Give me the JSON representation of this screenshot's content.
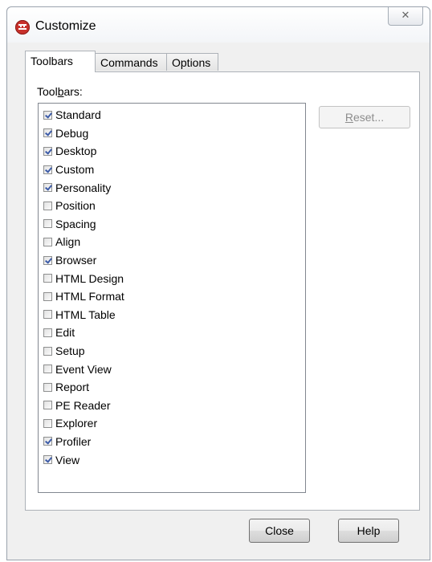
{
  "window": {
    "title": "Customize",
    "close_glyph": "✕"
  },
  "tabs": [
    {
      "label": "Toolbars",
      "active": true
    },
    {
      "label": "Commands",
      "active": false
    },
    {
      "label": "Options",
      "active": false
    }
  ],
  "panel": {
    "list_label_pre": "Tool",
    "list_label_mnemonic": "b",
    "list_label_post": "ars:",
    "reset_pre": "",
    "reset_mnemonic": "R",
    "reset_post": "eset..."
  },
  "toolbars": [
    {
      "label": "Standard",
      "checked": true
    },
    {
      "label": "Debug",
      "checked": true
    },
    {
      "label": "Desktop",
      "checked": true
    },
    {
      "label": "Custom",
      "checked": true
    },
    {
      "label": "Personality",
      "checked": true
    },
    {
      "label": "Position",
      "checked": false
    },
    {
      "label": "Spacing",
      "checked": false
    },
    {
      "label": "Align",
      "checked": false
    },
    {
      "label": "Browser",
      "checked": true
    },
    {
      "label": "HTML Design",
      "checked": false
    },
    {
      "label": "HTML Format",
      "checked": false
    },
    {
      "label": "HTML Table",
      "checked": false
    },
    {
      "label": "Edit",
      "checked": false
    },
    {
      "label": "Setup",
      "checked": false
    },
    {
      "label": "Event View",
      "checked": false
    },
    {
      "label": "Report",
      "checked": false
    },
    {
      "label": "PE Reader",
      "checked": false
    },
    {
      "label": "Explorer",
      "checked": false
    },
    {
      "label": "Profiler",
      "checked": true
    },
    {
      "label": "View",
      "checked": true
    }
  ],
  "buttons": {
    "close": "Close",
    "help": "Help"
  },
  "colors": {
    "icon_red": "#c8312c",
    "check_blue": "#3d5ca8"
  }
}
